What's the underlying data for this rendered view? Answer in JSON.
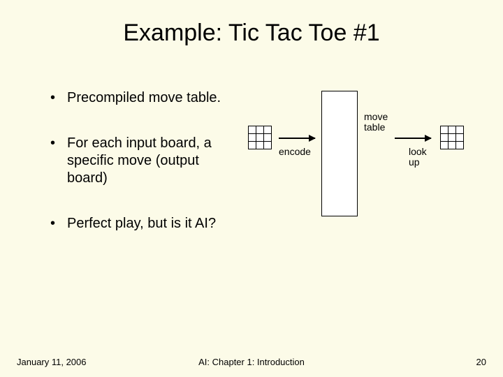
{
  "title": "Example: Tic Tac Toe #1",
  "bullets": [
    "Precompiled move table.",
    "For each input board, a specific move (output board)",
    "Perfect play, but is it AI?"
  ],
  "diagram": {
    "encode_label": "encode",
    "move_table_label_line1": "move",
    "move_table_label_line2": "table",
    "lookup_label_line1": "look",
    "lookup_label_line2": "up"
  },
  "footer": {
    "date": "January 11, 2006",
    "center": "AI: Chapter 1: Introduction",
    "page": "20"
  }
}
